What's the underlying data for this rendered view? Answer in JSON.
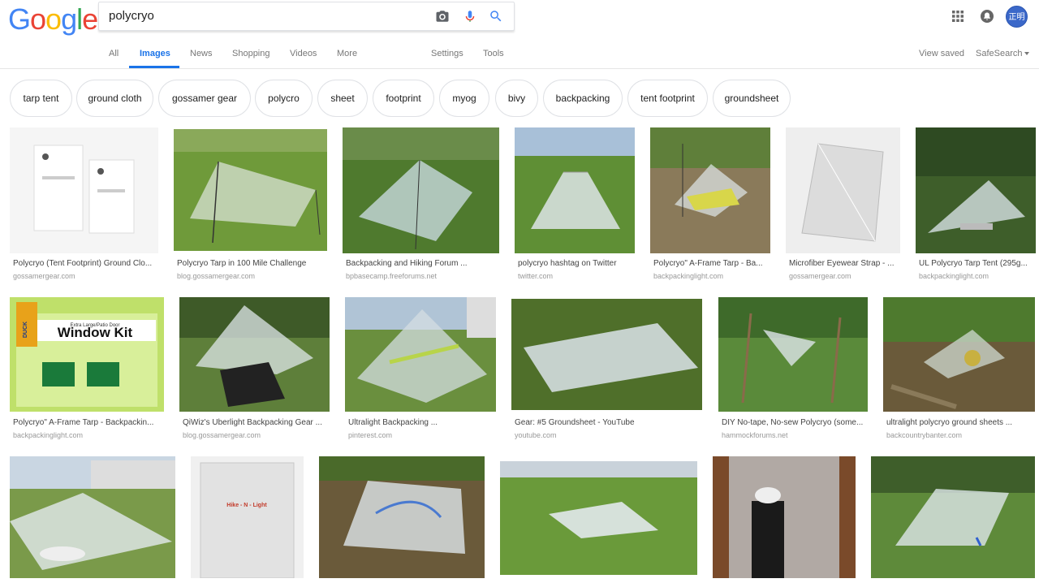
{
  "logo": {
    "text": "Google"
  },
  "search": {
    "value": "polycryo"
  },
  "tabs": {
    "all": "All",
    "images": "Images",
    "news": "News",
    "shopping": "Shopping",
    "videos": "Videos",
    "more": "More",
    "settings": "Settings",
    "tools": "Tools",
    "view_saved": "View saved",
    "safesearch": "SafeSearch"
  },
  "account": {
    "avatar_text": "正明"
  },
  "chips": [
    "tarp tent",
    "ground cloth",
    "gossamer gear",
    "polycro",
    "sheet",
    "footprint",
    "myog",
    "bivy",
    "backpacking",
    "tent footprint",
    "groundsheet"
  ],
  "results": [
    {
      "caption": "Polycryo (Tent Footprint) Ground Clo...",
      "source": "gossamergear.com"
    },
    {
      "caption": "Polycryo Tarp in 100 Mile Challenge",
      "source": "blog.gossamergear.com"
    },
    {
      "caption": "Backpacking and Hiking Forum ...",
      "source": "bpbasecamp.freeforums.net"
    },
    {
      "caption": "polycryo hashtag on Twitter",
      "source": "twitter.com"
    },
    {
      "caption": "Polycryo\" A-Frame Tarp - Ba...",
      "source": "backpackinglight.com"
    },
    {
      "caption": "Microfiber Eyewear Strap - ...",
      "source": "gossamergear.com"
    },
    {
      "caption": "UL Polycryo Tarp Tent (295g...",
      "source": "backpackinglight.com"
    },
    {
      "caption": "Polycryo\" A-Frame Tarp - Backpackin...",
      "source": "backpackinglight.com"
    },
    {
      "caption": "QiWiz's Uberlight Backpacking Gear ...",
      "source": "blog.gossamergear.com"
    },
    {
      "caption": "Ultralight Backpacking ...",
      "source": "pinterest.com"
    },
    {
      "caption": "Gear: #5 Groundsheet - YouTube",
      "source": "youtube.com"
    },
    {
      "caption": "DIY No-tape, No-sew Polycryo (some...",
      "source": "hammockforums.net"
    },
    {
      "caption": "ultralight polycryo ground sheets ...",
      "source": "backcountrybanter.com"
    }
  ],
  "image_text": {
    "duck_brand": "DUCK",
    "duck_title": "Window Kit",
    "duck_subtitle": "Extra Large/Patio Door",
    "hike_label": "Hike - N - Light"
  }
}
